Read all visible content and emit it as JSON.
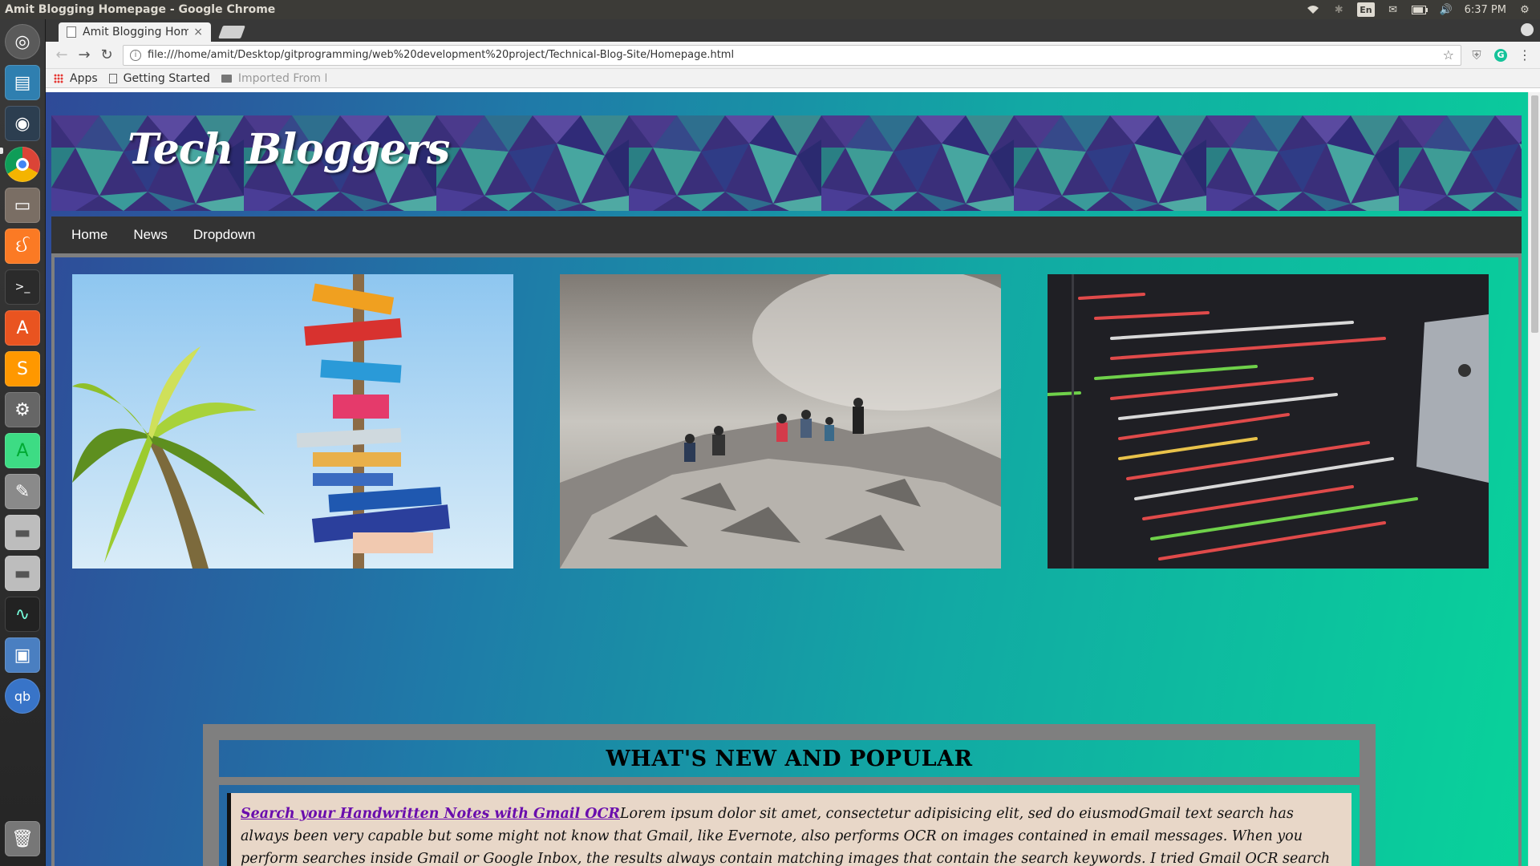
{
  "os_panel": {
    "window_title": "Amit Blogging Homepage - Google Chrome",
    "keyboard_layout": "En",
    "clock": "6:37 PM",
    "icons": [
      "wifi-icon",
      "bluetooth-icon",
      "mail-icon",
      "battery-icon",
      "volume-icon",
      "settings-gear-icon"
    ]
  },
  "launcher": {
    "items": [
      "ubuntu-dash-icon",
      "files-icon",
      "audio-app-icon",
      "chrome-icon",
      "file-manager-icon",
      "xampp-icon",
      "terminal-icon",
      "software-center-icon",
      "sublime-text-icon",
      "system-settings-icon",
      "android-studio-icon",
      "gimp-icon",
      "drive-icon",
      "drive-icon",
      "system-monitor-icon",
      "virtualbox-icon",
      "qbittorrent-icon",
      "trash-icon"
    ]
  },
  "browser": {
    "tab_title": "Amit Blogging Hom",
    "tab_close": "×",
    "url": "file:///home/amit/Desktop/gitprogramming/web%20development%20project/Technical-Blog-Site/Homepage.html",
    "bookmarks": {
      "apps": "Apps",
      "getting_started": "Getting Started",
      "imported": "Imported From F"
    }
  },
  "site": {
    "brand": "Tech Bloggers",
    "nav": [
      "Home",
      "News",
      "Dropdown"
    ],
    "popular_heading": "WHAT'S NEW AND POPULAR",
    "article": {
      "link": "Search your Handwritten Notes with Gmail OCR",
      "body": "Lorem ipsum dolor sit amet, consectetur adipisicing elit, sed do eiusmodGmail text search has always been very capable but some might not know that Gmail, like Evernote, also performs OCR on images contained in email messages. When you perform searches inside Gmail or Google Inbox, the results always contain matching images that contain the search keywords. I tried Gmail OCR search against different types of images and the results were fairly good. Text recognition in Gmail works"
    }
  },
  "colors": {
    "bg_start": "#2f4a98",
    "bg_end": "#08d49a",
    "navbar": "#333333",
    "frame": "#7f7f7f",
    "article_bg": "#e8d7c8",
    "link": "#6a0dad"
  }
}
